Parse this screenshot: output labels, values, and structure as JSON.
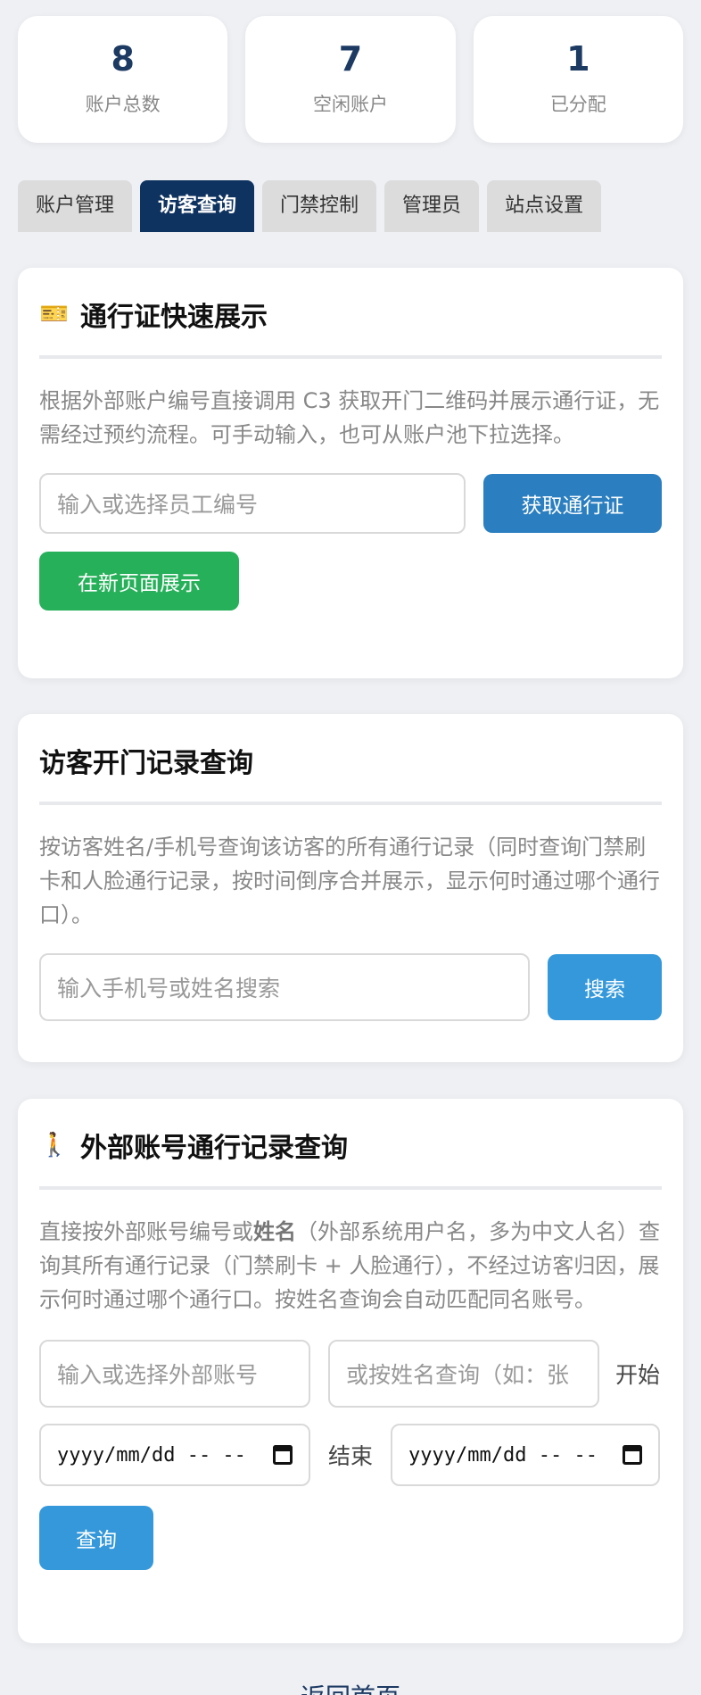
{
  "stats": [
    {
      "value": "8",
      "label": "账户总数"
    },
    {
      "value": "7",
      "label": "空闲账户"
    },
    {
      "value": "1",
      "label": "已分配"
    }
  ],
  "tabs": [
    {
      "label": "账户管理",
      "active": false
    },
    {
      "label": "访客查询",
      "active": true
    },
    {
      "label": "门禁控制",
      "active": false
    },
    {
      "label": "管理员",
      "active": false
    },
    {
      "label": "站点设置",
      "active": false
    }
  ],
  "pass_card": {
    "icon": "ticket-icon",
    "title": "通行证快速展示",
    "description": "根据外部账户编号直接调用 C3 获取开门二维码并展示通行证，无需经过预约流程。可手动输入，也可从账户池下拉选择。",
    "input_placeholder": "输入或选择员工编号",
    "get_button": "获取通行证",
    "show_button": "在新页面展示"
  },
  "visitor_card": {
    "title": "访客开门记录查询",
    "description": "按访客姓名/手机号查询该访客的所有通行记录（同时查询门禁刷卡和人脸通行记录，按时间倒序合并展示，显示何时通过哪个通行口）。",
    "search_placeholder": "输入手机号或姓名搜索",
    "search_button": "搜索"
  },
  "external_card": {
    "icon": "walking-person-icon",
    "title": "外部账号通行记录查询",
    "description_pre": "直接按外部账号编号或",
    "description_bold": "姓名",
    "description_post": "（外部系统用户名，多为中文人名）查询其所有通行记录（门禁刷卡 + 人脸通行），不经过访客归因，展示何时通过哪个通行口。按姓名查询会自动匹配同名账号。",
    "account_placeholder": "输入或选择外部账号",
    "name_placeholder": "或按姓名查询（如：张",
    "start_label": "开始",
    "end_label": "结束",
    "date_placeholder": "yyyy/mm/dd -- --",
    "query_button": "查询"
  },
  "footer": {
    "back_link": "返回首页"
  }
}
